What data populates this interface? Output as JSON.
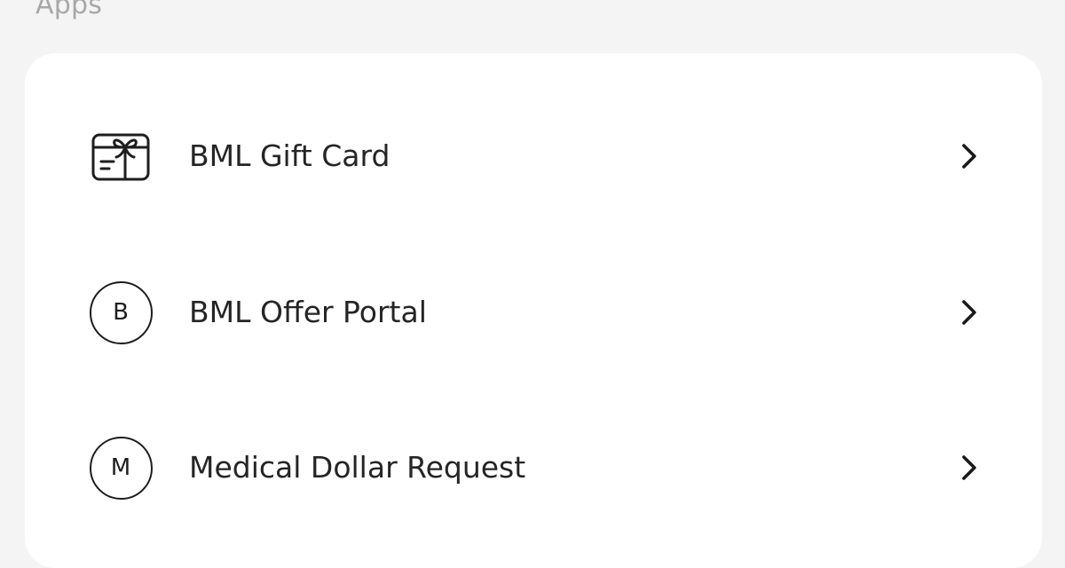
{
  "section": {
    "title": "Apps"
  },
  "apps": [
    {
      "label": "BML Gift Card",
      "icon": "gift-card-icon"
    },
    {
      "label": "BML Offer Portal",
      "icon": "letter-b-icon",
      "icon_letter": "B"
    },
    {
      "label": "Medical Dollar Request",
      "icon": "letter-m-icon",
      "icon_letter": "M"
    }
  ],
  "colors": {
    "background": "#f4f4f4",
    "card": "#ffffff",
    "section_title": "#a8a8a8",
    "text": "#252525"
  }
}
